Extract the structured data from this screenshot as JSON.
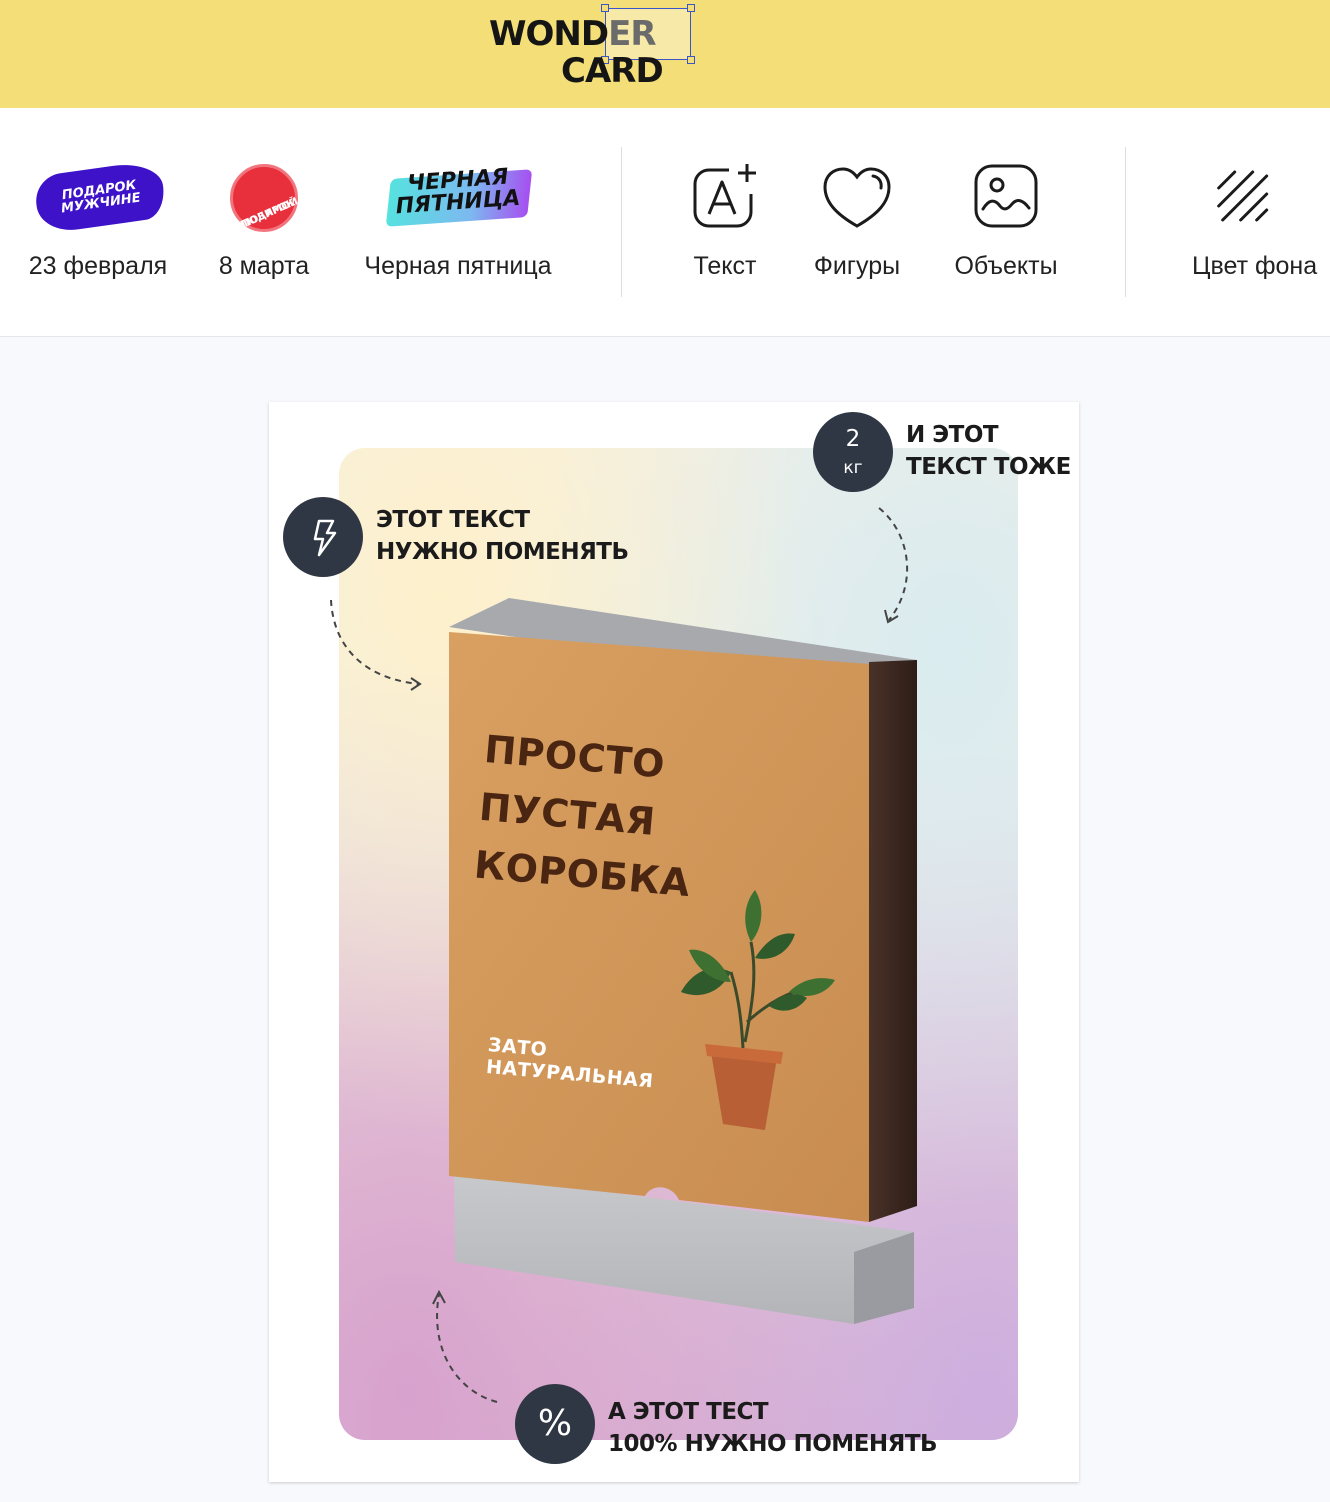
{
  "header": {
    "logo_line1_main": "WOND",
    "logo_line1_dim": "ER",
    "logo_line2": "CARD",
    "background": "#f3de78"
  },
  "toolbar": {
    "templates": [
      {
        "label": "23 февраля",
        "sticker_lines": [
          "ПОДАРОК",
          "МУЖЧИНЕ"
        ]
      },
      {
        "label": "8 марта",
        "sticker_lines": [
          "ПОДАРОК",
          "ЛЮБИМОЙ"
        ]
      },
      {
        "label": "Черная пятница",
        "sticker_lines": [
          "ЧЕРНАЯ",
          "ПЯТНИЦА"
        ]
      }
    ],
    "tools": [
      {
        "label": "Текст",
        "icon": "add-text-icon"
      },
      {
        "label": "Фигуры",
        "icon": "heart-shape-icon"
      },
      {
        "label": "Объекты",
        "icon": "image-object-icon"
      }
    ],
    "background_tool": {
      "label": "Цвет фона",
      "icon": "diagonal-lines-icon"
    }
  },
  "canvas": {
    "note_top_left": [
      "ЭТОТ ТЕКСТ",
      "НУЖНО ПОМЕНЯТЬ"
    ],
    "note_top_right": [
      "И ЭТОТ",
      "ТЕКСТ ТОЖЕ"
    ],
    "note_bottom": [
      "А ЭТОТ ТЕСТ",
      "100% НУЖНО ПОМЕНЯТЬ"
    ],
    "weight_badge": {
      "value": "2",
      "unit": "кг"
    },
    "lightning_badge_icon": "lightning-icon",
    "percent_badge_symbol": "%",
    "box_title": [
      "ПРОСТО",
      "ПУСТАЯ",
      "КОРОБКА"
    ],
    "box_subtitle": [
      "ЗАТО",
      "НАТУРАЛЬНАЯ"
    ],
    "accent_dark": "#2f3744",
    "box_color": "#d49a5c"
  }
}
